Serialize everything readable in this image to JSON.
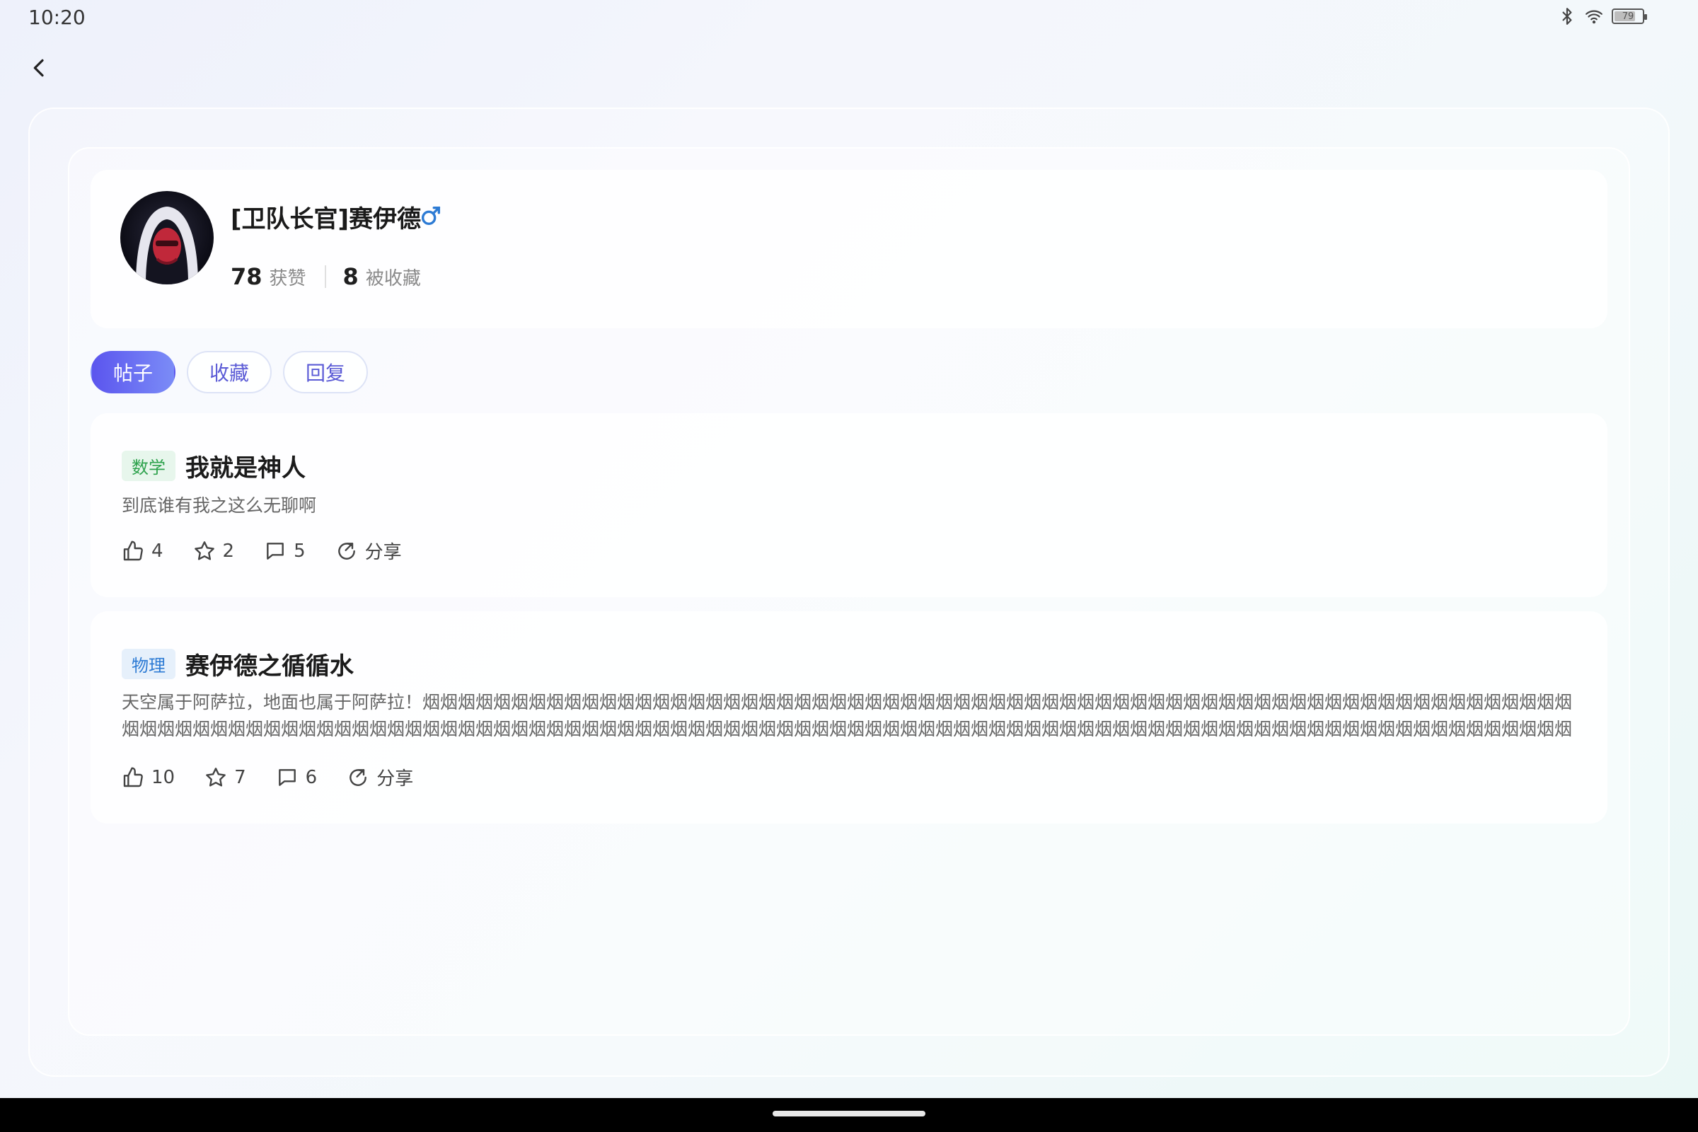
{
  "status_bar": {
    "time": "10:20",
    "battery_level": "79",
    "battery_fraction": 0.79
  },
  "profile": {
    "name": "[卫队长官]赛伊德",
    "gender": "male",
    "gender_color": "#2d7bd4",
    "likes_count": "78",
    "likes_label": "获赞",
    "favorited_count": "8",
    "favorited_label": "被收藏"
  },
  "tabs": [
    {
      "label": "帖子",
      "active": true
    },
    {
      "label": "收藏",
      "active": false
    },
    {
      "label": "回复",
      "active": false
    }
  ],
  "posts": [
    {
      "tag": "数学",
      "title": "我就是神人",
      "excerpt": "到底谁有我之这么无聊啊",
      "likes": "4",
      "stars": "2",
      "comments": "5",
      "share_label": "分享"
    },
    {
      "tag": "物理",
      "title": "赛伊德之循循水",
      "excerpt": "天空属于阿萨拉，地面也属于阿萨拉！烟烟烟烟烟烟烟烟烟烟烟烟烟烟烟烟烟烟烟烟烟烟烟烟烟烟烟烟烟烟烟烟烟烟烟烟烟烟烟烟烟烟烟烟烟烟烟烟烟烟烟烟烟烟烟烟烟烟烟烟烟烟烟烟烟烟烟烟烟烟烟烟烟烟烟烟烟烟烟烟烟烟烟烟烟烟烟烟烟烟烟烟烟烟烟烟烟烟烟烟烟烟烟烟烟烟烟烟烟烟烟烟烟烟烟烟烟烟烟烟烟烟烟烟烟烟烟烟烟烟烟烟烟烟烟烟烟烟烟烟烟烟烟烟烟烟烟烟烟烟烟烟烟烟烟烟烟烟…",
      "likes": "10",
      "stars": "7",
      "comments": "6",
      "share_label": "分享"
    }
  ],
  "colors": {
    "accent": "#5b55ee",
    "tag_math_text": "#2ea24d",
    "tag_physics_text": "#2d7bd4"
  }
}
